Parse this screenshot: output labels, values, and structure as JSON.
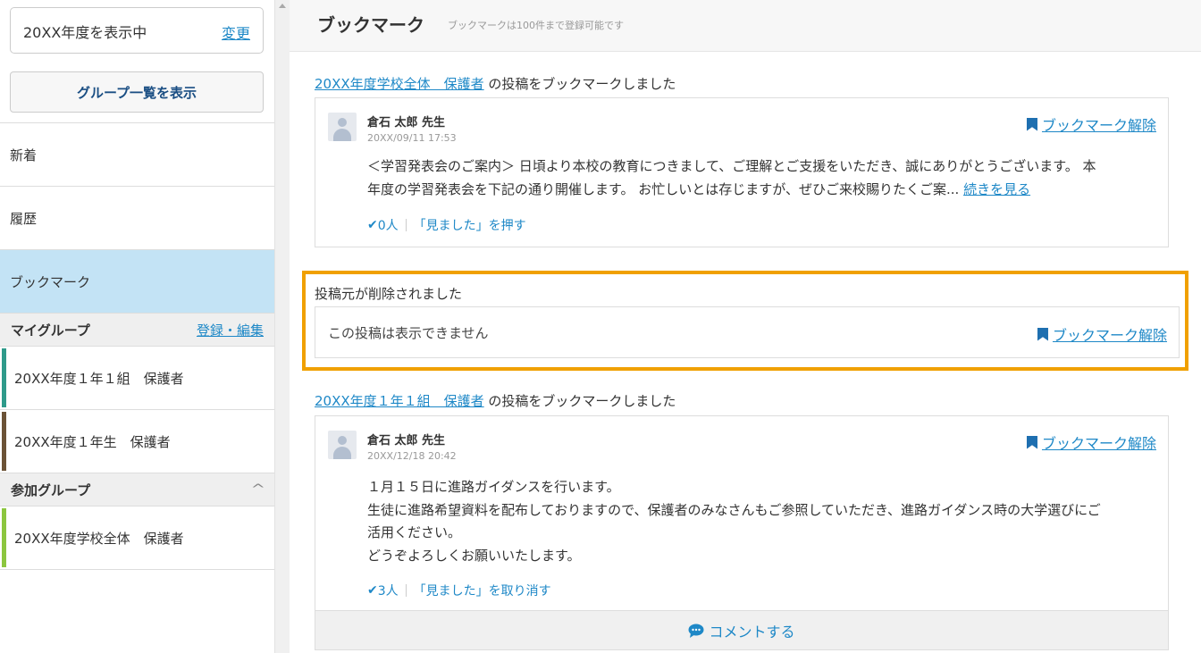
{
  "sidebar": {
    "year_text": "20XX年度を表示中",
    "year_change": "変更",
    "group_list_button": "グループ一覧を表示",
    "nav": [
      {
        "label": "新着"
      },
      {
        "label": "履歴"
      },
      {
        "label": "ブックマーク"
      }
    ],
    "my_groups_header": "マイグループ",
    "my_groups_action": "登録・編集",
    "my_groups": [
      {
        "label": "20XX年度１年１組　保護者",
        "color": "#2e9a8a"
      },
      {
        "label": "20XX年度１年生　保護者",
        "color": "#6b5236"
      }
    ],
    "joined_groups_header": "参加グループ",
    "joined_groups_toggle": "^",
    "joined_groups": [
      {
        "label": "20XX年度学校全体　保護者",
        "color": "#8cc63f"
      }
    ]
  },
  "main": {
    "title": "ブックマーク",
    "subtitle": "ブックマークは100件まで登録可能です",
    "posts": [
      {
        "group_link": "20XX年度学校全体　保護者",
        "suffix": " の投稿をブックマークしました",
        "author": "倉石 太郎 先生",
        "date": "20XX/09/11 17:53",
        "unbookmark": "ブックマーク解除",
        "body_line1": "＜学習発表会のご案内＞ 日頃より本校の教育につきまして、ご理解とご支援をいただき、誠にありがとうございます。 本",
        "body_line2": "年度の学習発表会を下記の通り開催します。 お忙しいとは存じますが、ぜひご来校賜りたくご案...",
        "read_more": "続きを見る",
        "seen_count": "0人",
        "seen_action": "「見ました」を押す"
      },
      {
        "group_link": "20XX年度１年１組　保護者",
        "suffix": " の投稿をブックマークしました",
        "author": "倉石 太郎 先生",
        "date": "20XX/12/18 20:42",
        "unbookmark": "ブックマーク解除",
        "body_lines": [
          "１月１５日に進路ガイダンスを行います。",
          "生徒に進路希望資料を配布しておりますので、保護者のみなさんもご参照していただき、進路ガイダンス時の大学選びにご",
          "活用ください。",
          "どうぞよろしくお願いいたします。"
        ],
        "seen_count": "3人",
        "seen_action": "「見ました」を取り消す",
        "comment": "コメントする"
      }
    ],
    "deleted": {
      "label": "投稿元が削除されました",
      "message": "この投稿は表示できません",
      "unbookmark": "ブックマーク解除",
      "highlight_color": "#f0a000"
    }
  }
}
